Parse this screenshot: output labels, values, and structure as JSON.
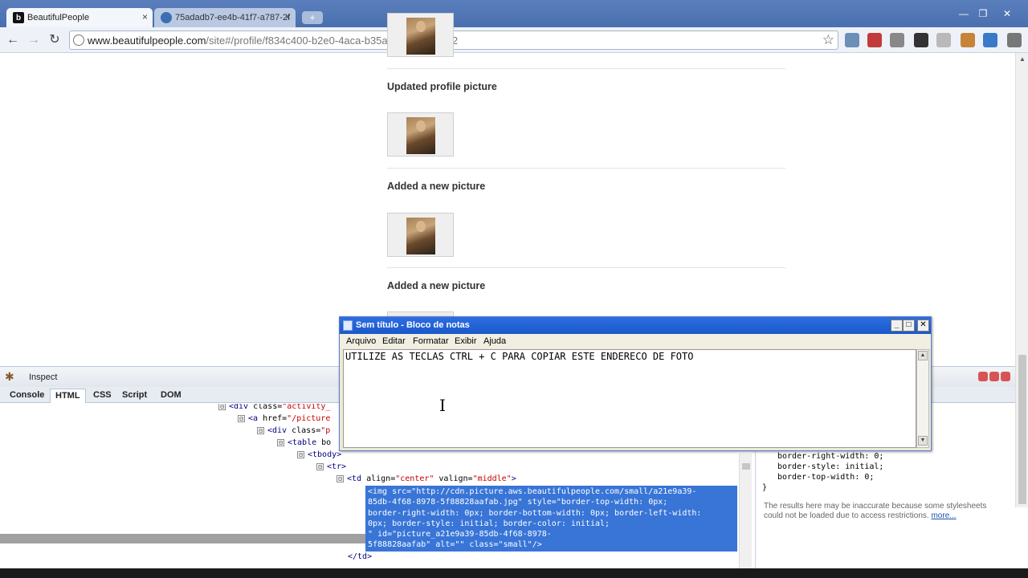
{
  "browser": {
    "tabs": [
      {
        "favicon": "b",
        "title": "BeautifulPeople",
        "close": "×"
      },
      {
        "favicon": "",
        "title": "75adadb7-ee4b-41f7-a787-2f",
        "close": "×"
      }
    ],
    "new_tab": "+",
    "window_controls": {
      "minimize": "—",
      "maximize": "❐",
      "close": "✕"
    },
    "nav": {
      "back": "←",
      "forward": "→",
      "reload": "↻"
    },
    "address": {
      "host": "www.beautifulpeople.com",
      "path": "/site#/profile/f834c400-b2e0-4aca-b35a-b9928a635fb2"
    },
    "star": "☆"
  },
  "page": {
    "activities": [
      {
        "title": "Updated profile picture"
      },
      {
        "title": "Added a new picture"
      },
      {
        "title": "Added a new picture"
      }
    ]
  },
  "firebug": {
    "inspect_label": "Inspect",
    "tabs": [
      "Console",
      "HTML",
      "CSS",
      "Script",
      "DOM"
    ],
    "active_tab": "HTML",
    "tree": [
      {
        "twisty": "⊟",
        "tag_open": "<div ",
        "attr": "class=",
        "val": "\"activity_"
      },
      {
        "twisty": "⊟",
        "tag_open": "<a ",
        "attr": "href=",
        "val": "\"/picture"
      },
      {
        "twisty": "⊟",
        "tag_open": "<div ",
        "attr": "class=",
        "val": "\"p"
      },
      {
        "twisty": "⊟",
        "tag_open": "<table ",
        "attr": "bo",
        "val": ""
      },
      {
        "twisty": "⊟",
        "tag_open": "<tbody>",
        "attr": "",
        "val": ""
      },
      {
        "twisty": "⊟",
        "tag_open": "<tr>",
        "attr": "",
        "val": ""
      },
      {
        "twisty": "⊟",
        "tag_open": "<td ",
        "attr": "align=",
        "val": "\"center\"",
        "attr2": " valign=",
        "val2": "\"middle\"",
        "close": ">"
      }
    ],
    "selected_lines": [
      "<img src=\"http://cdn.picture.aws.beautifulpeople.com/small/a21e9a39-",
      "85db-4f68-8978-5f88828aafab.jpg\" style=\"border-top-width: 0px;",
      "border-right-width: 0px; border-bottom-width: 0px; border-left-width:",
      "0px; border-style: initial; border-color: initial;",
      "\" id=\"picture_a21e9a39-85db-4f68-8978-",
      "5f88828aafab\" alt=\"\" class=\"small\"/>"
    ],
    "td_close": "</td>",
    "styles": [
      "border-right-width: 0;",
      "border-style: initial;",
      "border-top-width: 0;"
    ],
    "style_brace": "}",
    "note_text": "The results here may be inaccurate because some stylesheets could not be loaded due to access restrictions.",
    "note_link": "more..."
  },
  "notepad": {
    "title": "Sem título - Bloco de notas",
    "menu": [
      "Arquivo",
      "Editar",
      "Formatar",
      "Exibir",
      "Ajuda"
    ],
    "content": "UTILIZE AS TECLAS CTRL + C PARA COPIAR ESTE ENDERECO DE FOTO",
    "buttons": {
      "minimize": "_",
      "maximize": "□",
      "close": "✕"
    }
  },
  "colors": {
    "tabstrip": "#4a6fae",
    "selection": "#3875d7",
    "notepad_title": "#1b58c9"
  }
}
